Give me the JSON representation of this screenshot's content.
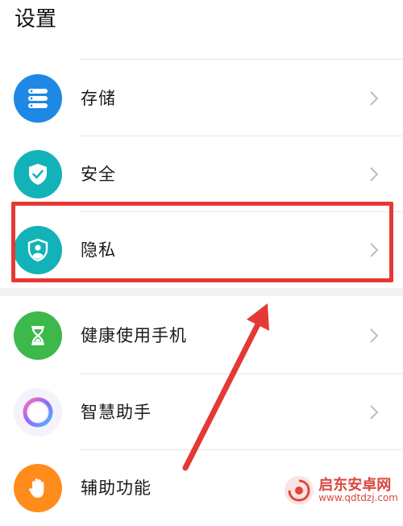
{
  "header": {
    "title": "设置"
  },
  "rows": [
    {
      "label": "存储",
      "icon": "storage-icon",
      "color": "#1e88e5"
    },
    {
      "label": "安全",
      "icon": "shield-check-icon",
      "color": "#12b3b8"
    },
    {
      "label": "隐私",
      "icon": "privacy-person-shield-icon",
      "color": "#12b3b8"
    },
    {
      "label": "健康使用手机",
      "icon": "hourglass-icon",
      "color": "#3cb94a"
    },
    {
      "label": "智慧助手",
      "icon": "assistant-ring-icon",
      "color": "#a86cf0"
    },
    {
      "label": "辅助功能",
      "icon": "hand-icon",
      "color": "#ff8c1a"
    }
  ],
  "annotation": {
    "highlight_color": "#e53935"
  },
  "watermark": {
    "name": "启东安卓网",
    "url": "www.qdtdzj.com"
  }
}
